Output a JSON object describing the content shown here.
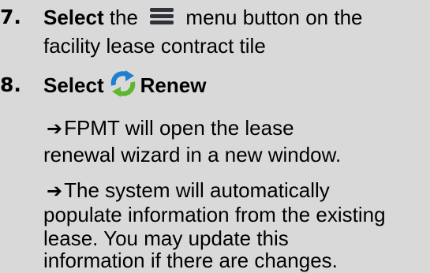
{
  "steps": [
    {
      "number": "7.",
      "bold_word": "Select",
      "text_before_icon": " the ",
      "icon": "menu-icon",
      "text_after_icon": " menu button on the",
      "line2": "facility lease contract tile"
    },
    {
      "number": "8.",
      "bold_word": "Select",
      "icon": "renew-icon",
      "bold_after_icon": "Renew"
    }
  ],
  "notes": [
    {
      "arrow": "➔",
      "lines": [
        "FPMT will open the lease",
        "renewal wizard in a new window."
      ]
    },
    {
      "arrow": "➔",
      "lines": [
        "The system will automatically",
        "populate information from the existing",
        "lease. You may update this",
        "information if there are changes."
      ]
    }
  ],
  "colors": {
    "background": "#d9d9d9",
    "text": "#000000",
    "menu_icon": "#2f3338",
    "renew_blue": "#1e7fd0",
    "renew_green": "#5cb82e"
  }
}
